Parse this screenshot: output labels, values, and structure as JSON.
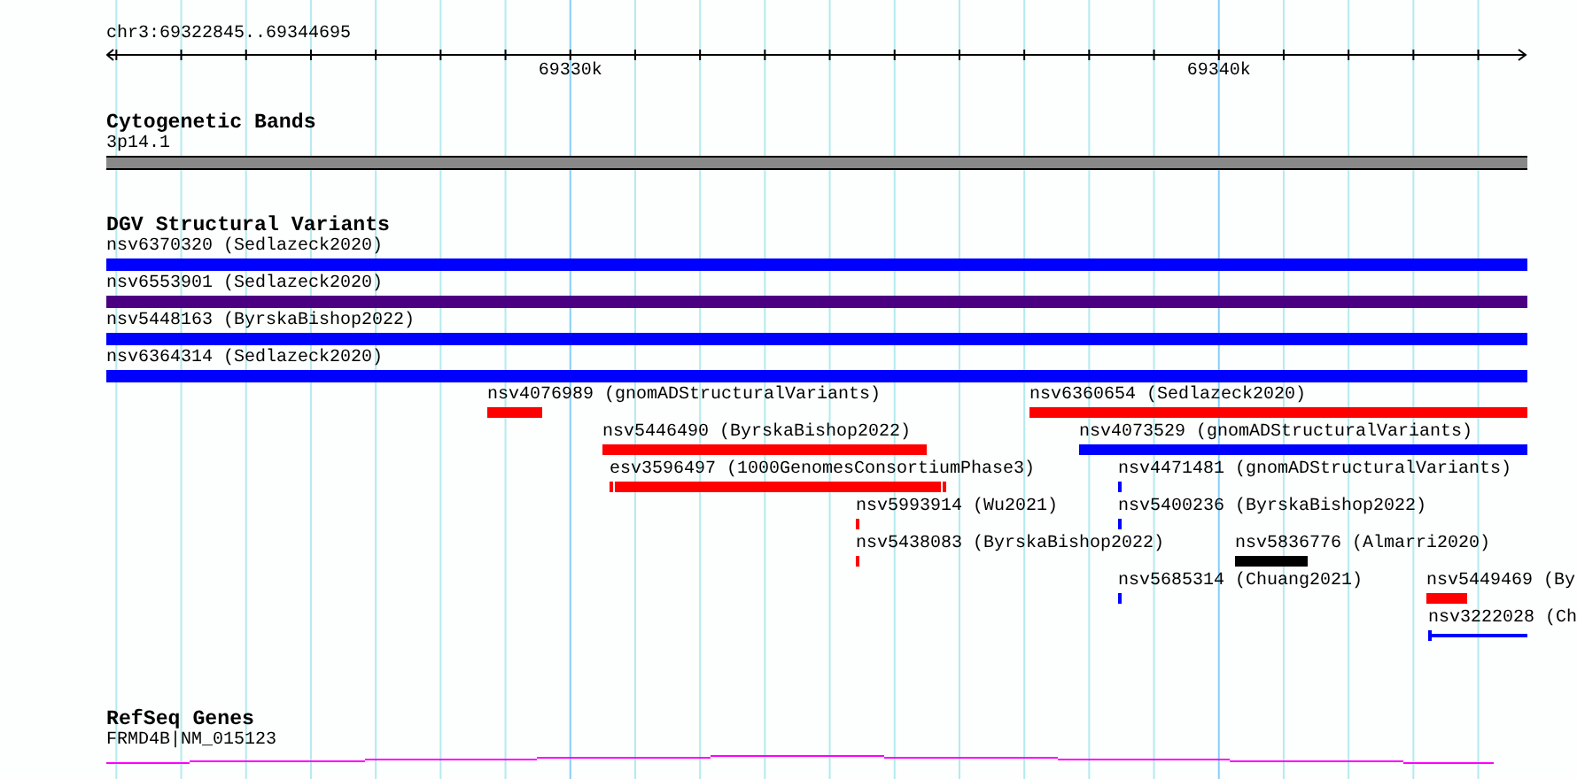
{
  "ruler": {
    "location": "chr3:69322845..69344695",
    "ticks": [
      {
        "label": "69330k"
      },
      {
        "label": "69340k"
      }
    ]
  },
  "tracks": [
    {
      "kind": "cytoband",
      "title": "Cytogenetic Bands",
      "label": "3p14.1"
    },
    {
      "kind": "variants",
      "title": "DGV Structural Variants",
      "rows": [
        {
          "features": [
            {
              "label": "nsv6370320 (Sedlazeck2020)",
              "color": "#0000ff",
              "kind": "bar"
            }
          ]
        },
        {
          "features": [
            {
              "label": "nsv6553901 (Sedlazeck2020)",
              "color": "#4b0082",
              "kind": "bar"
            }
          ]
        },
        {
          "features": [
            {
              "label": "nsv5448163 (ByrskaBishop2022)",
              "color": "#0000ff",
              "kind": "bar"
            }
          ]
        },
        {
          "features": [
            {
              "label": "nsv6364314 (Sedlazeck2020)",
              "color": "#0000ff",
              "kind": "bar"
            }
          ]
        },
        {
          "features": [
            {
              "label": "nsv4076989 (gnomADStructuralVariants)",
              "color": "#ff0000",
              "kind": "bar"
            },
            {
              "label": "nsv6360654 (Sedlazeck2020)",
              "color": "#ff0000",
              "kind": "bar"
            }
          ]
        },
        {
          "features": [
            {
              "label": "nsv5446490 (ByrskaBishop2022)",
              "color": "#ff0000",
              "kind": "bar"
            },
            {
              "label": "nsv4073529 (gnomADStructuralVariants)",
              "color": "#0000ff",
              "kind": "bar"
            }
          ]
        },
        {
          "features": [
            {
              "label": "esv3596497 (1000GenomesConsortiumPhase3)",
              "color": "#ff0000",
              "kind": "capped"
            },
            {
              "label": "nsv4471481 (gnomADStructuralVariants)",
              "color": "#0000ff",
              "kind": "bar"
            }
          ]
        },
        {
          "features": [
            {
              "label": "nsv5993914 (Wu2021)",
              "color": "#ff0000",
              "kind": "bar"
            },
            {
              "label": "nsv5400236 (ByrskaBishop2022)",
              "color": "#0000ff",
              "kind": "bar"
            }
          ]
        },
        {
          "features": [
            {
              "label": "nsv5438083 (ByrskaBishop2022)",
              "color": "#ff0000",
              "kind": "bar"
            },
            {
              "label": "nsv5836776 (Almarri2020)",
              "color": "#000000",
              "kind": "bar"
            }
          ]
        },
        {
          "features": [
            {
              "label": "nsv5685314 (Chuang2021)",
              "color": "#0000ff",
              "kind": "bar"
            },
            {
              "label": "nsv5449469 (By",
              "color": "#ff0000",
              "kind": "bar"
            }
          ]
        },
        {
          "features": [
            {
              "label": "nsv3222028 (Ch",
              "color": "#0000ff",
              "kind": "line"
            }
          ]
        }
      ]
    },
    {
      "kind": "genes",
      "title": "RefSeq Genes",
      "label": "FRMD4B|NM_015123"
    }
  ]
}
